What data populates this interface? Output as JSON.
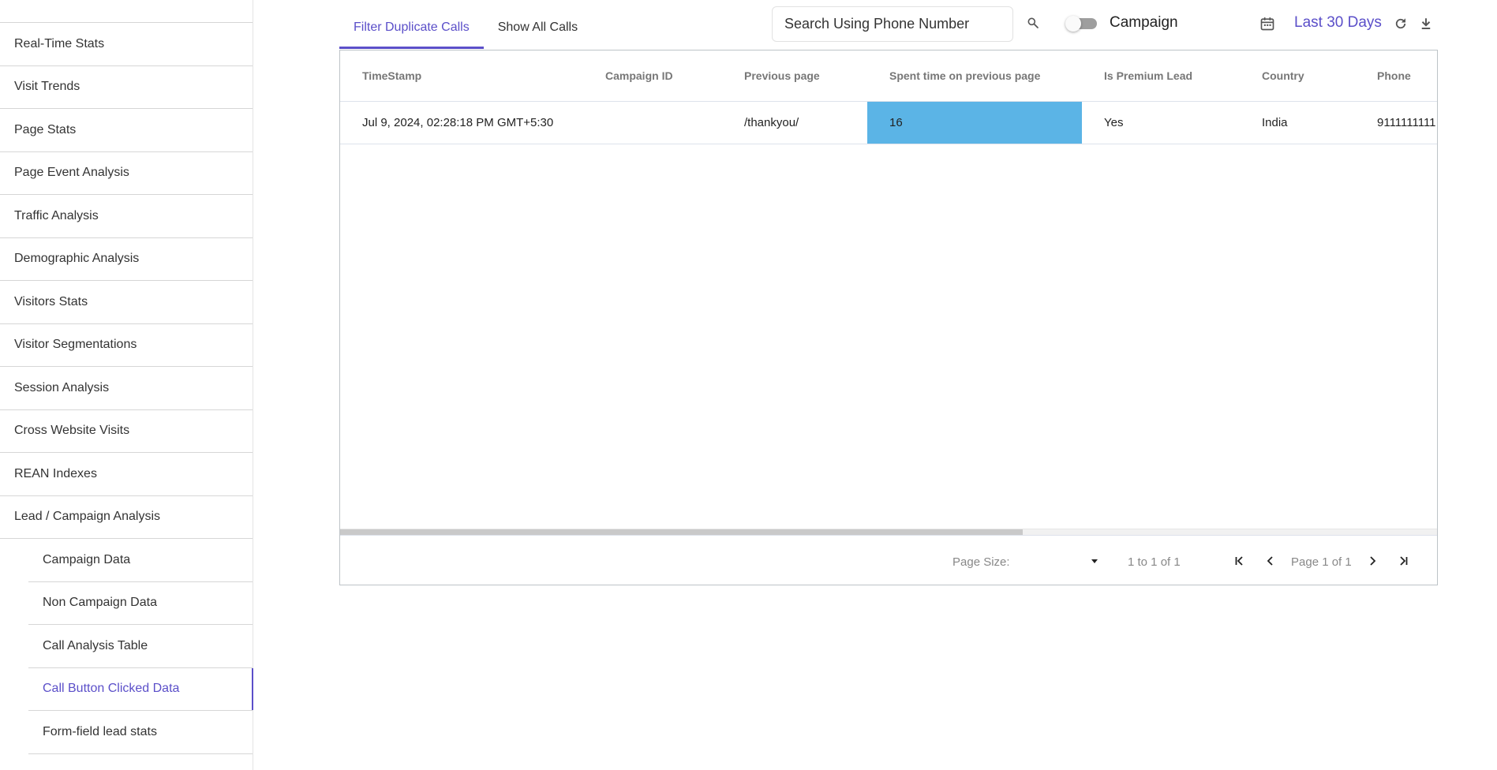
{
  "sidebar": {
    "items": [
      {
        "label": "Real-Time Stats"
      },
      {
        "label": "Visit Trends"
      },
      {
        "label": "Page Stats"
      },
      {
        "label": "Page Event Analysis"
      },
      {
        "label": "Traffic Analysis"
      },
      {
        "label": "Demographic Analysis"
      },
      {
        "label": "Visitors Stats"
      },
      {
        "label": "Visitor Segmentations"
      },
      {
        "label": "Session Analysis"
      },
      {
        "label": "Cross Website Visits"
      },
      {
        "label": "REAN Indexes"
      },
      {
        "label": "Lead / Campaign Analysis"
      }
    ],
    "sub_items": [
      {
        "label": "Campaign Data"
      },
      {
        "label": "Non Campaign Data"
      },
      {
        "label": "Call Analysis Table"
      },
      {
        "label": "Call Button Clicked Data",
        "active": true
      },
      {
        "label": "Form-field lead stats"
      }
    ]
  },
  "tabs": [
    {
      "label": "Filter Duplicate Calls",
      "active": true
    },
    {
      "label": "Show All Calls",
      "active": false
    }
  ],
  "toolbar": {
    "search_placeholder": "Search Using Phone Number",
    "toggle_label": "Campaign",
    "toggle_on": false,
    "date_range": "Last 30 Days"
  },
  "table": {
    "columns": [
      "TimeStamp",
      "Campaign ID",
      "Previous page",
      "Spent time on previous page",
      "Is Premium Lead",
      "Country",
      "Phone"
    ],
    "rows": [
      [
        "Jul 9, 2024, 02:28:18 PM GMT+5:30",
        "",
        "/thankyou/",
        "16",
        "Yes",
        "India",
        "9111111111"
      ]
    ]
  },
  "pagination": {
    "page_size_label": "Page Size:",
    "page_size_value": "",
    "summary": "1 to 1 of 1",
    "page_desc": "Page 1 of 1"
  },
  "colors": {
    "accent": "#5b4fc9",
    "highlight_cell": "#5bb4e6"
  }
}
